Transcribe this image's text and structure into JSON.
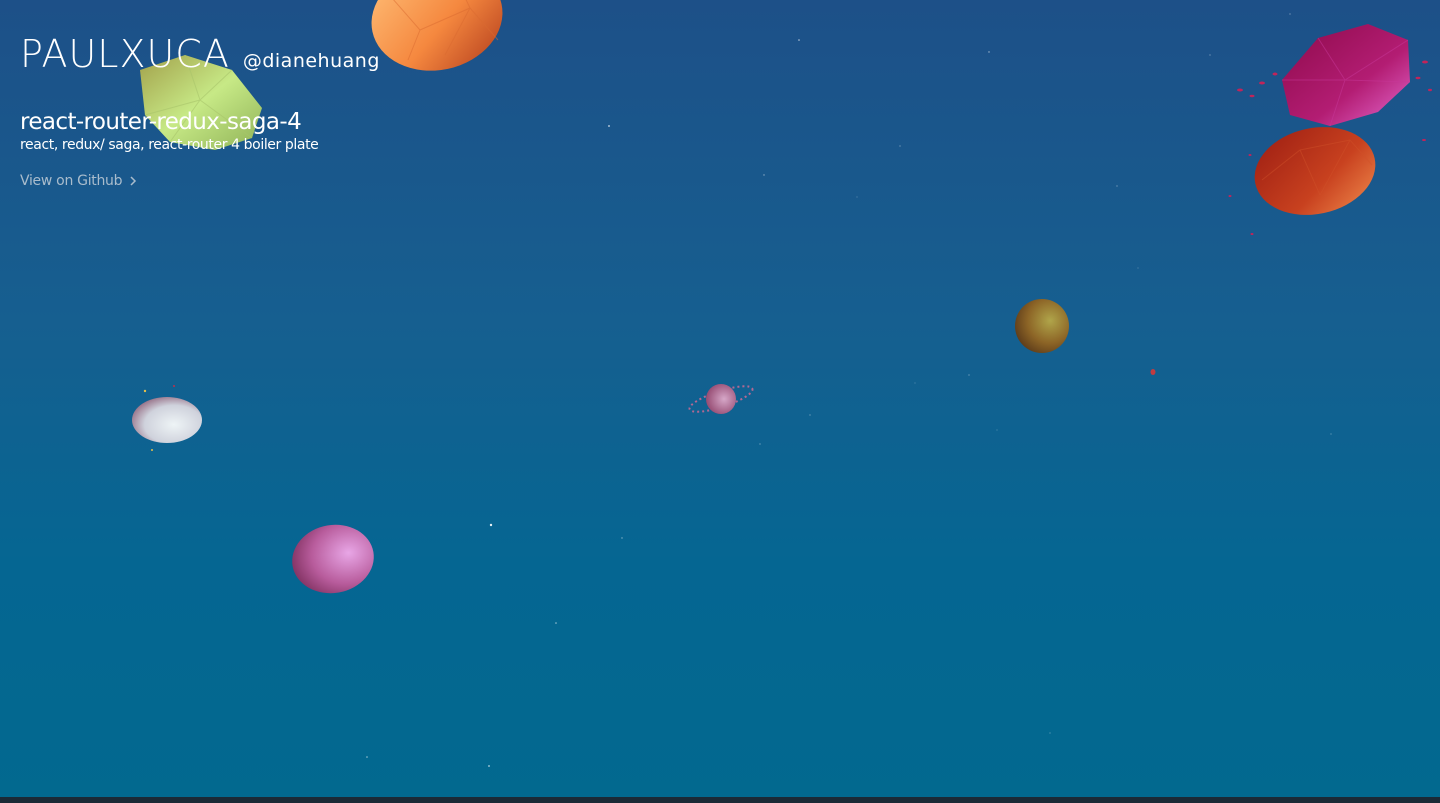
{
  "brand": {
    "logo": "PAULXUCA",
    "handle": "@dianehuang"
  },
  "project": {
    "title": "react-router-redux-saga-4",
    "description": "react, redux/ saga, react-router 4 boiler plate",
    "link_label": "View on Github"
  },
  "icons": {
    "link_chevron": "chevron-right-icon"
  },
  "colors": {
    "background_top": "#1d5088",
    "background_bottom": "#02698f",
    "link": "#a9bccc"
  }
}
